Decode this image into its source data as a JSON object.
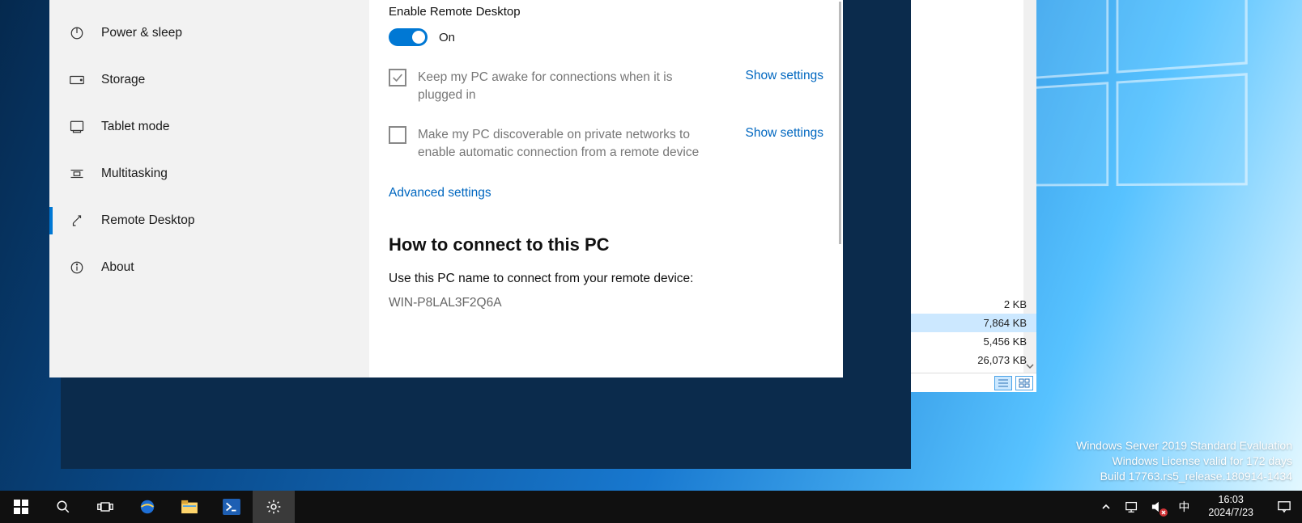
{
  "sidebar": {
    "items": [
      {
        "label": "Power & sleep",
        "icon": "power-icon"
      },
      {
        "label": "Storage",
        "icon": "storage-icon"
      },
      {
        "label": "Tablet mode",
        "icon": "tablet-icon"
      },
      {
        "label": "Multitasking",
        "icon": "multitasking-icon"
      },
      {
        "label": "Remote Desktop",
        "icon": "remote-desktop-icon",
        "selected": true
      },
      {
        "label": "About",
        "icon": "about-icon"
      }
    ]
  },
  "content": {
    "section_title": "Enable Remote Desktop",
    "toggle_state": "On",
    "opt1_text": "Keep my PC awake for connections when it is plugged in",
    "opt1_link": "Show settings",
    "opt2_text": "Make my PC discoverable on private networks to enable automatic connection from a remote device",
    "opt2_link": "Show settings",
    "advanced_link": "Advanced settings",
    "connect_heading": "How to connect to this PC",
    "connect_instr": "Use this PC name to connect from your remote device:",
    "pc_name": "WIN-P8LAL3F2Q6A"
  },
  "explorer": {
    "rows": [
      {
        "size": "2 KB"
      },
      {
        "size": "7,864 KB",
        "selected": true
      },
      {
        "size": "5,456 KB"
      },
      {
        "size": "26,073 KB"
      }
    ]
  },
  "watermark": {
    "line1": "Windows Server 2019 Standard Evaluation",
    "line2": "Windows License valid for 172 days",
    "line3": "Build 17763.rs5_release.180914-1434"
  },
  "taskbar": {
    "time": "16:03",
    "date": "2024/7/23",
    "ime": "中"
  }
}
